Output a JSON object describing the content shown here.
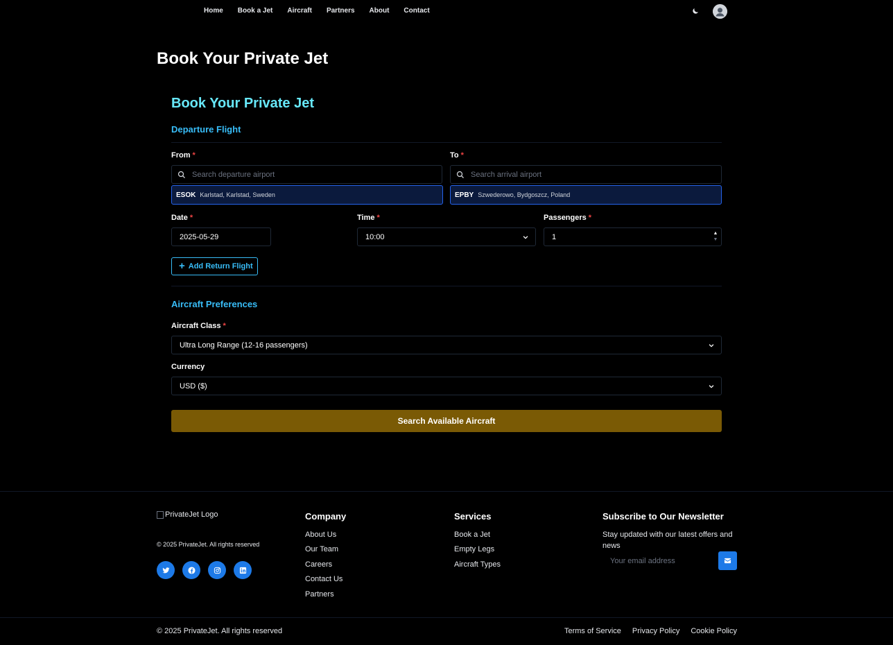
{
  "nav": {
    "items": [
      "Home",
      "Book a Jet",
      "Aircraft",
      "Partners",
      "About",
      "Contact"
    ],
    "theme_icon": "moon-icon",
    "avatar_icon": "user-avatar-icon"
  },
  "page_title": "Book Your Private Jet",
  "form": {
    "title": "Book Your Private Jet",
    "departure_section": "Departure Flight",
    "from_label": "From",
    "from_placeholder": "Search departure airport",
    "from_selected": {
      "code": "ESOK",
      "name": "Karlstad, Karlstad, Sweden"
    },
    "to_label": "To",
    "to_placeholder": "Search arrival airport",
    "to_selected": {
      "code": "EPBY",
      "name": "Szwederowo, Bydgoszcz, Poland"
    },
    "date_label": "Date",
    "date_value": "2025-05-29",
    "time_label": "Time",
    "time_value": "10:00",
    "passengers_label": "Passengers",
    "passengers_value": "1",
    "required_mark": "*",
    "return_button": "Add Return Flight",
    "prefs_section": "Aircraft Preferences",
    "class_label": "Aircraft Class",
    "class_value": "Ultra Long Range (12-16 passengers)",
    "currency_label": "Currency",
    "currency_value": "USD ($)",
    "search_button": "Search Available Aircraft"
  },
  "footer": {
    "logo_alt": "PrivateJet Logo",
    "copyright": "© 2025 PrivateJet. All rights reserved",
    "socials": [
      "twitter-icon",
      "facebook-icon",
      "instagram-icon",
      "linkedin-icon"
    ],
    "company_title": "Company",
    "company_links": [
      "About Us",
      "Our Team",
      "Careers",
      "Contact Us",
      "Partners"
    ],
    "services_title": "Services",
    "services_links": [
      "Book a Jet",
      "Empty Legs",
      "Aircraft Types"
    ],
    "newsletter_title": "Subscribe to Our Newsletter",
    "newsletter_text": "Stay updated with our latest offers and news",
    "email_placeholder": "Your email address",
    "bottom_copyright": "© 2025 PrivateJet. All rights reserved",
    "legal_links": [
      "Terms of Service",
      "Privacy Policy",
      "Cookie Policy"
    ]
  },
  "colors": {
    "accent_cyan": "#67e8f9",
    "accent_sky": "#38bdf8",
    "primary_button": "#7a5a05",
    "social_blue": "#1d7ae8",
    "required_red": "#ef4444"
  }
}
